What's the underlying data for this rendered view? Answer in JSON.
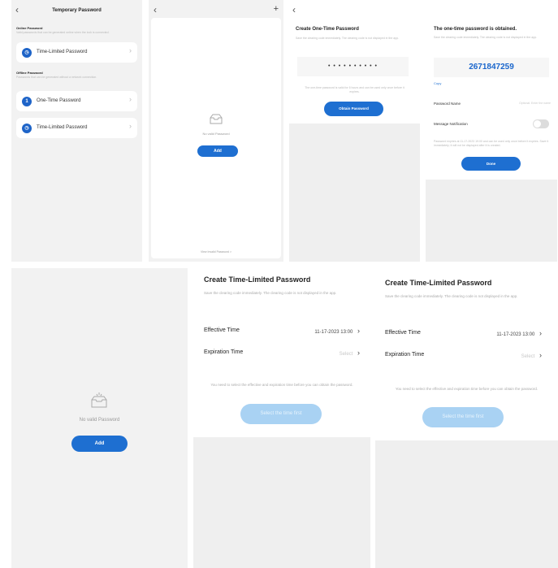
{
  "colors": {
    "accent": "#1e6fd1",
    "disabled_button": "#a9d2f3",
    "page_gray": "#f2f2f2"
  },
  "screen1": {
    "title": "Temporary Password",
    "online_section": "Online Password",
    "online_desc": "Valid passwords that can be generated online when the lock is connected.",
    "time_limited_label": "Time-Limited Password",
    "offline_section": "Offline Password",
    "offline_desc": "Passwords that can be generated without a network connection.",
    "one_time_label": "One-Time Password",
    "time_limited_label_2": "Time-Limited Password"
  },
  "screen2": {
    "empty_text": "No valid Password",
    "add_label": "Add",
    "footer_link": "View Invalid Password >"
  },
  "screen3": {
    "title": "Create One-Time Password",
    "subtitle": "Save the clearing code immediately. The clearing code is not displayed in the app.",
    "password_mask": "• • • • • • • • • •",
    "note": "The one-time password is valid for 6 hours and can be used only once before it expires.",
    "obtain_label": "Obtain Password"
  },
  "screen4": {
    "title": "The one-time password is obtained.",
    "subtitle": "Save the clearing code immediately. The clearing code is not displayed in the app.",
    "password": "2671847259",
    "copy_label": "Copy",
    "name_label": "Password Name",
    "name_placeholder": "Optional: Enter the name",
    "notification_label": "Message Notification",
    "validity_note": "Password expires at 11-17-2023 19:00 and can be used only once before it expires. Save it immediately; it will not be displayed after it is created.",
    "done_label": "Done"
  },
  "screen5": {
    "empty_text": "No valid Password",
    "add_label": "Add"
  },
  "screen6": {
    "title": "Create Time-Limited Password",
    "subtitle": "Save the clearing code immediately. The clearing code is not displayed in the app.",
    "effective_label": "Effective Time",
    "effective_value": "11-17-2023 13:00",
    "expiration_label": "Expiration Time",
    "expiration_value": "Select",
    "note": "You need to select the effective and expiration time before you can obtain the password.",
    "button_label": "Select the time first"
  },
  "screen7": {
    "title": "Create Time-Limited Password",
    "subtitle": "Save the clearing code immediately. The clearing code is not displayed in the app.",
    "effective_label": "Effective Time",
    "effective_value": "11-17-2023 13:00",
    "expiration_label": "Expiration Time",
    "expiration_value": "Select",
    "note": "You need to select the effective and expiration time before you can obtain the password.",
    "button_label": "Select the time first"
  }
}
